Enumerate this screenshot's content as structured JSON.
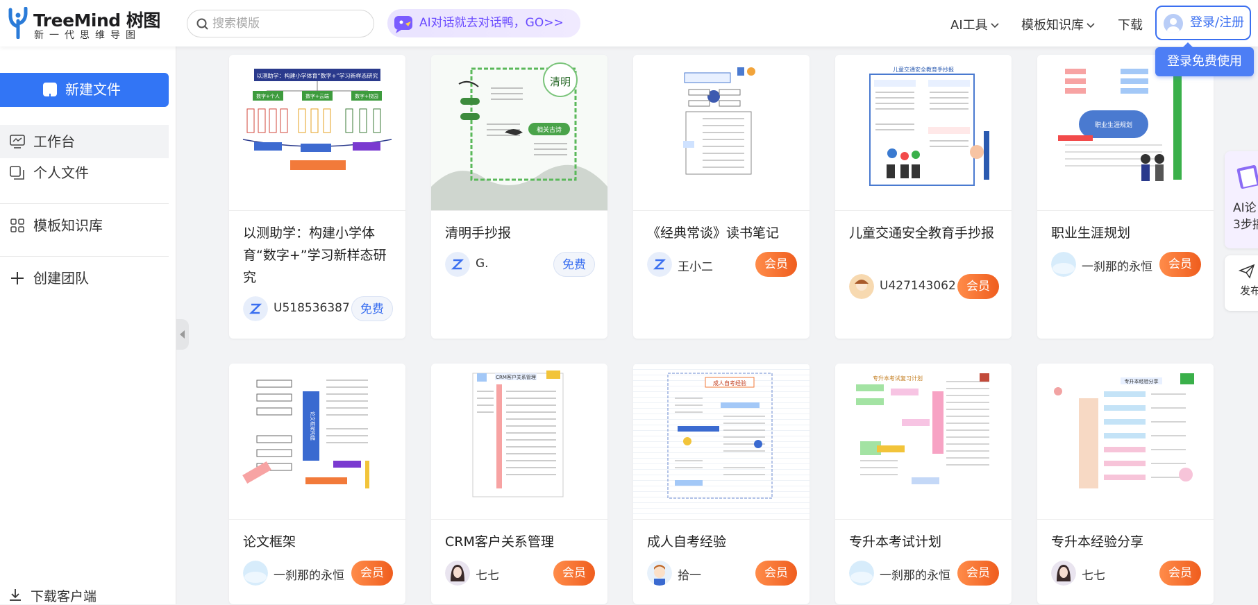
{
  "header": {
    "logo_title": "TreeMind 树图",
    "logo_subtitle": "新一代思维导图",
    "search_placeholder": "搜索模版",
    "ai_banner": "AI对话就去对话鸭，GO>>",
    "nav": [
      {
        "label": "AI工具"
      },
      {
        "label": "模板知识库"
      },
      {
        "label": "下载"
      }
    ],
    "login_label": "登录/注册",
    "login_tooltip": "登录免费使用"
  },
  "sidebar": {
    "new_file_label": "新建文件",
    "items": [
      {
        "label": "工作台",
        "icon": "monitor-icon",
        "active": true
      },
      {
        "label": "个人文件",
        "icon": "files-icon",
        "active": false
      },
      {
        "label": "模板知识库",
        "icon": "grid-icon",
        "active": false
      },
      {
        "label": "创建团队",
        "icon": "plus-icon",
        "active": false
      }
    ],
    "download_label": "下载客户端"
  },
  "right_panel": {
    "ai_text_1": "AI论",
    "ai_text_2": "3步搞",
    "publish_text": "发布"
  },
  "cards": [
    {
      "title": "以测助学：构建小学体育“数字+”学习新样态研究",
      "author": "U518536387",
      "badge": "免费",
      "type": "free"
    },
    {
      "title": "清明手抄报",
      "author": "G.",
      "badge": "免费",
      "type": "free"
    },
    {
      "title": "《经典常谈》读书笔记",
      "author": "王小二",
      "badge": "会员",
      "type": "vip"
    },
    {
      "title": "儿童交通安全教育手抄报",
      "author": "U427143062",
      "badge": "会员",
      "type": "vip"
    },
    {
      "title": "职业生涯规划",
      "author": "一刹那的永恒",
      "badge": "会员",
      "type": "vip"
    },
    {
      "title": "论文框架",
      "author": "一刹那的永恒",
      "badge": "会员",
      "type": "vip"
    },
    {
      "title": "CRM客户关系管理",
      "author": "七七",
      "badge": "会员",
      "type": "vip"
    },
    {
      "title": "成人自考经验",
      "author": "拾一",
      "badge": "会员",
      "type": "vip"
    },
    {
      "title": "专升本考试计划",
      "author": "一刹那的永恒",
      "badge": "会员",
      "type": "vip"
    },
    {
      "title": "专升本经验分享",
      "author": "七七",
      "badge": "会员",
      "type": "vip"
    }
  ],
  "thumb_texts": {
    "t0_title": "以测助学：构建小学体育“数字+”学习新样态研究",
    "t0_a": "数字+个人",
    "t0_b": "数字+云端",
    "t0_c": "数字+校园",
    "t1_a": "清明",
    "t1_b": "相关古诗",
    "t3_a": "儿童交通安全教育手抄报",
    "t4_a": "职业生涯规划",
    "t5_a": "论文框架构建",
    "t6_a": "CRM客户关系管理",
    "t7_a": "成人自考经验",
    "t8_a": "专升本考试复习计划",
    "t9_a": "专升本经验分享"
  },
  "colors": {
    "accent": "#3275f5",
    "vip_badge": "#ef5d1e",
    "free_badge_text": "#3a6ff0",
    "ai_banner_text": "#6a4bff"
  }
}
